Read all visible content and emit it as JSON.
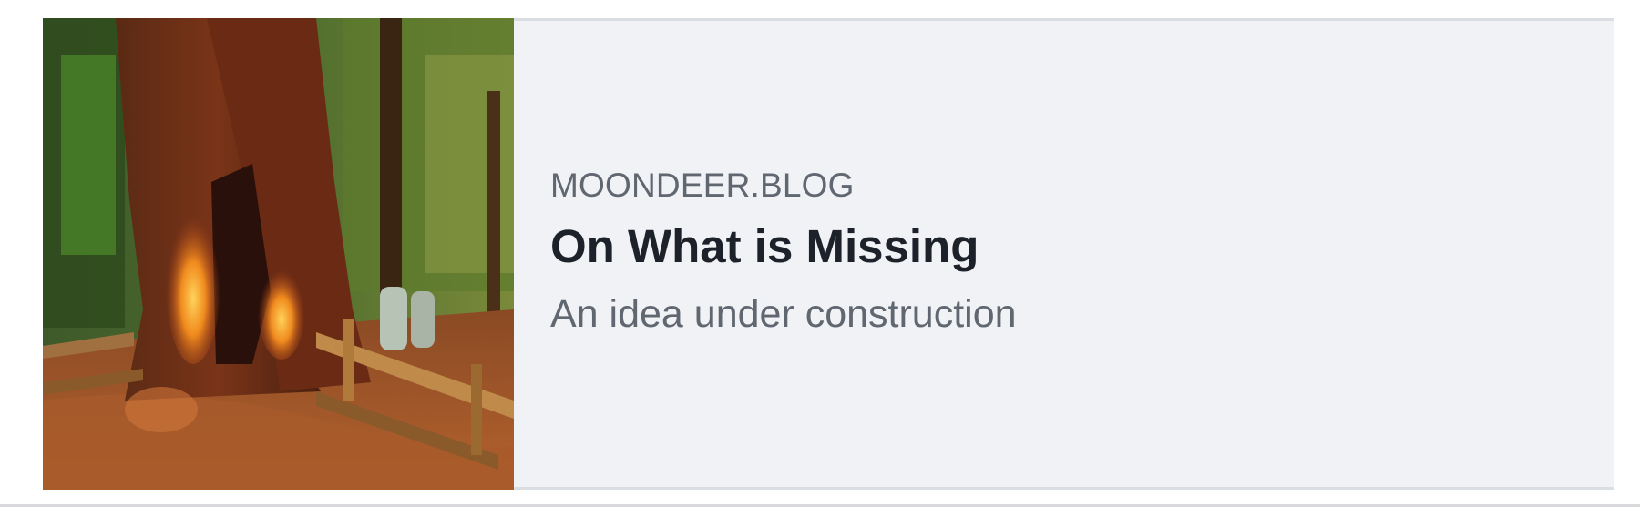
{
  "link_preview": {
    "domain": "MOONDEER.BLOG",
    "title": "On What is Missing",
    "description": "An idea under construction"
  }
}
